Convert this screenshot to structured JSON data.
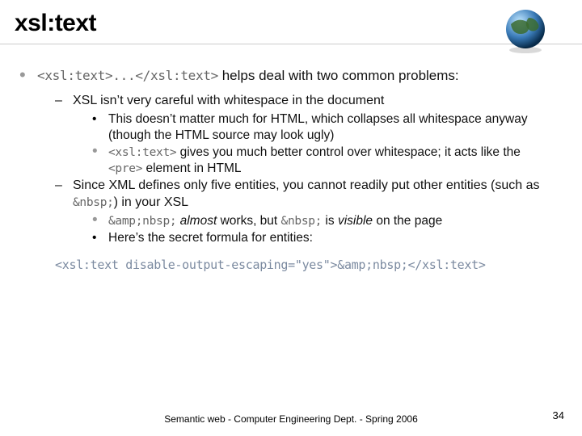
{
  "title": "xsl:text",
  "bullet1": {
    "code": "<xsl:text>...</xsl:text>",
    "rest": " helps deal with two common problems:"
  },
  "dash1": "XSL isn’t very careful with whitespace in the document",
  "dash1_sub1": "This doesn’t matter much for HTML, which collapses all whitespace anyway (though the HTML source may look ugly)",
  "dash1_sub2_code": "<xsl:text>",
  "dash1_sub2_rest": " gives you much better control over whitespace; it acts like the ",
  "dash1_sub2_code2": "<pre>",
  "dash1_sub2_rest2": " element in HTML",
  "dash2_a": "Since XML defines only five entities, you cannot readily put other entities (such as ",
  "dash2_code": "&nbsp;",
  "dash2_b": ") in your XSL",
  "dash2_sub1_code": "&amp;nbsp;",
  "dash2_sub1_mid": " almost",
  "dash2_sub1_rest": " works, but ",
  "dash2_sub1_code2": "&nbsp;",
  "dash2_sub1_rest2": " is ",
  "dash2_sub1_vis": "visible",
  "dash2_sub1_rest3": " on the page",
  "dash2_sub2": "Here’s the secret formula for entities:",
  "formula": "<xsl:text  disable-output-escaping=\"yes\">&amp;nbsp;</xsl:text>",
  "footer": "Semantic web - Computer Engineering Dept. - Spring 2006",
  "page": "34"
}
